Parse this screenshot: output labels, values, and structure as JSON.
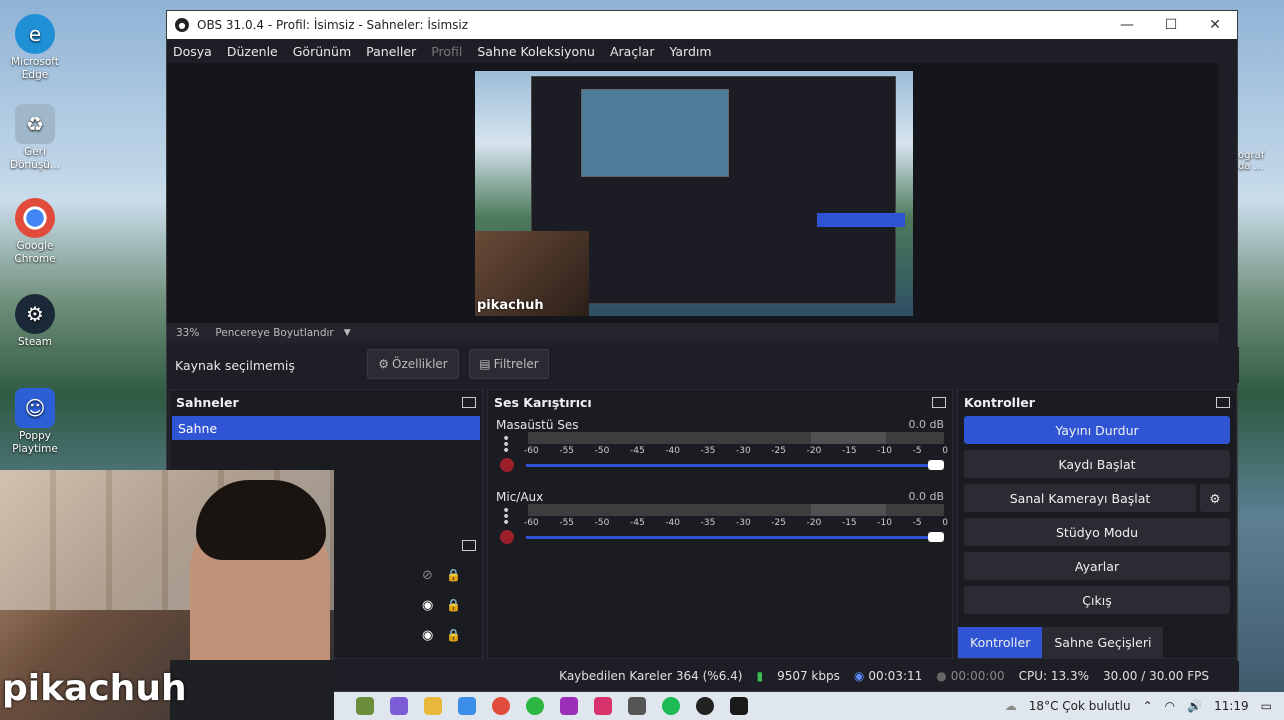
{
  "desktop": {
    "icons": [
      {
        "label": "Microsoft Edge",
        "color": "#1f8fd6"
      },
      {
        "label": "Geri Dönüşü...",
        "color": "#9fb7c9"
      },
      {
        "label": "Google Chrome",
        "color": "#e04b3b"
      },
      {
        "label": "Steam",
        "color": "#1b2838"
      },
      {
        "label": "Poppy Playtime",
        "color": "#2c5fd6"
      }
    ],
    "right_peek": "ograf\nda ..."
  },
  "obs": {
    "title": "OBS 31.0.4 - Profil: İsimsiz - Sahneler: İsimsiz",
    "menu": [
      "Dosya",
      "Düzenle",
      "Görünüm",
      "Paneller",
      "Profil",
      "Sahne Koleksiyonu",
      "Araçlar",
      "Yardım"
    ],
    "preview_overlay_text": "pikachuh",
    "zoom": {
      "percent": "33%",
      "mode": "Pencereye Boyutlandır"
    },
    "source_bar": {
      "status": "Kaynak seçilmemiş",
      "properties": "Özellikler",
      "filters": "Filtreler"
    },
    "scenes": {
      "title": "Sahneler",
      "items": [
        "Sahne"
      ]
    },
    "mixer": {
      "title": "Ses Karıştırıcı",
      "channels": [
        {
          "name": "Masaüstü Ses",
          "db": "0.0 dB"
        },
        {
          "name": "Mic/Aux",
          "db": "0.0 dB"
        }
      ],
      "ticks": [
        "-60",
        "-55",
        "-50",
        "-45",
        "-40",
        "-35",
        "-30",
        "-25",
        "-20",
        "-15",
        "-10",
        "-5",
        "0"
      ]
    },
    "controls": {
      "title": "Kontroller",
      "buttons": [
        "Yayını Durdur",
        "Kaydı Başlat",
        "Sanal Kamerayı Başlat",
        "Stüdyo Modu",
        "Ayarlar",
        "Çıkış"
      ],
      "tabs": [
        "Kontroller",
        "Sahne Geçişleri"
      ]
    },
    "status": {
      "dropped": "Kaybedilen Kareler 364 (%6.4)",
      "bitrate": "9507 kbps",
      "stream_time": "00:03:11",
      "rec_time": "00:00:00",
      "cpu": "CPU: 13.3%",
      "fps": "30.00 / 30.00 FPS"
    }
  },
  "webcam": {
    "name": "pikachuh"
  },
  "taskbar": {
    "weather": "18°C  Çok bulutlu",
    "time": "11:19"
  },
  "colors": {
    "accent": "#2f55d4",
    "panel": "#1b1c22",
    "window": "#1e1f26"
  }
}
